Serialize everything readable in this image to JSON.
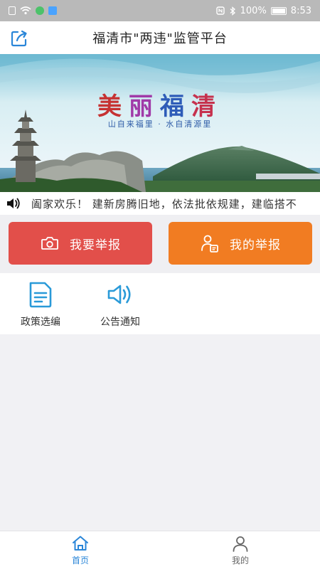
{
  "status_bar": {
    "battery": "100%",
    "time": "8:53"
  },
  "header": {
    "title": "福清市\"两违\"监管平台",
    "share_icon": "share-icon"
  },
  "banner": {
    "title_chars": [
      "美",
      "丽",
      "福",
      "清"
    ],
    "subtitle": "山自来福里 · 水自清源里"
  },
  "notice": {
    "icon": "speaker-icon",
    "text": "阖家欢乐！ 建新房腾旧地，依法批依规建，建临搭不"
  },
  "actions": {
    "report": {
      "label": "我要举报",
      "icon": "camera-icon",
      "color": "#e24f4a"
    },
    "my_reports": {
      "label": "我的举报",
      "icon": "user-document-icon",
      "color": "#f17c22"
    }
  },
  "features": [
    {
      "label": "政策选编",
      "icon": "document-icon"
    },
    {
      "label": "公告通知",
      "icon": "speaker-icon"
    }
  ],
  "tabbar": {
    "home": {
      "label": "首页",
      "icon": "home-icon",
      "active": true,
      "color": "#2a86d8"
    },
    "mine": {
      "label": "我的",
      "icon": "user-icon",
      "active": false
    }
  }
}
